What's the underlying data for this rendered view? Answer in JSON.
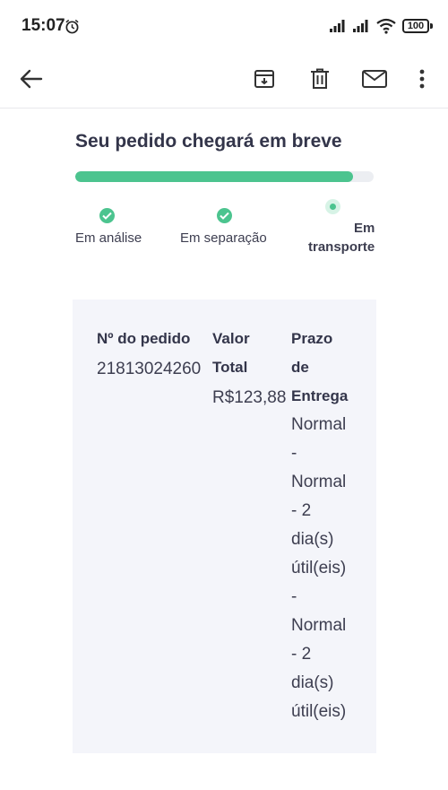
{
  "status_bar": {
    "time": "15:07",
    "battery": "100"
  },
  "toolbar": {
    "icons": [
      "back-arrow-icon",
      "archive-icon",
      "trash-icon",
      "mail-icon",
      "more-vert-icon"
    ]
  },
  "order_status": {
    "title": "Seu pedido chegará em breve",
    "progress": 0.93,
    "steps": [
      {
        "label": "Em análise",
        "state": "done"
      },
      {
        "label": "Em separação",
        "state": "done"
      },
      {
        "label_line1": "Em",
        "label_line2": "transporte",
        "state": "current"
      }
    ]
  },
  "order_details": {
    "order_number": {
      "header": "Nº do pedido",
      "value": "21813024260"
    },
    "total": {
      "header_line1": "Valor",
      "header_line2": "Total",
      "value": "R$123,88"
    },
    "delivery": {
      "header_lines": [
        "Prazo",
        "de",
        "Entrega"
      ],
      "value_lines": [
        "Normal",
        "-",
        "Normal",
        "- 2",
        "dia(s)",
        "útil(eis)",
        "-",
        "Normal",
        "- 2",
        "dia(s)",
        "útil(eis)"
      ]
    }
  },
  "colors": {
    "accent": "#4cc48f",
    "track": "#eceef2",
    "box": "#f4f5fa",
    "text": "#33354a"
  }
}
